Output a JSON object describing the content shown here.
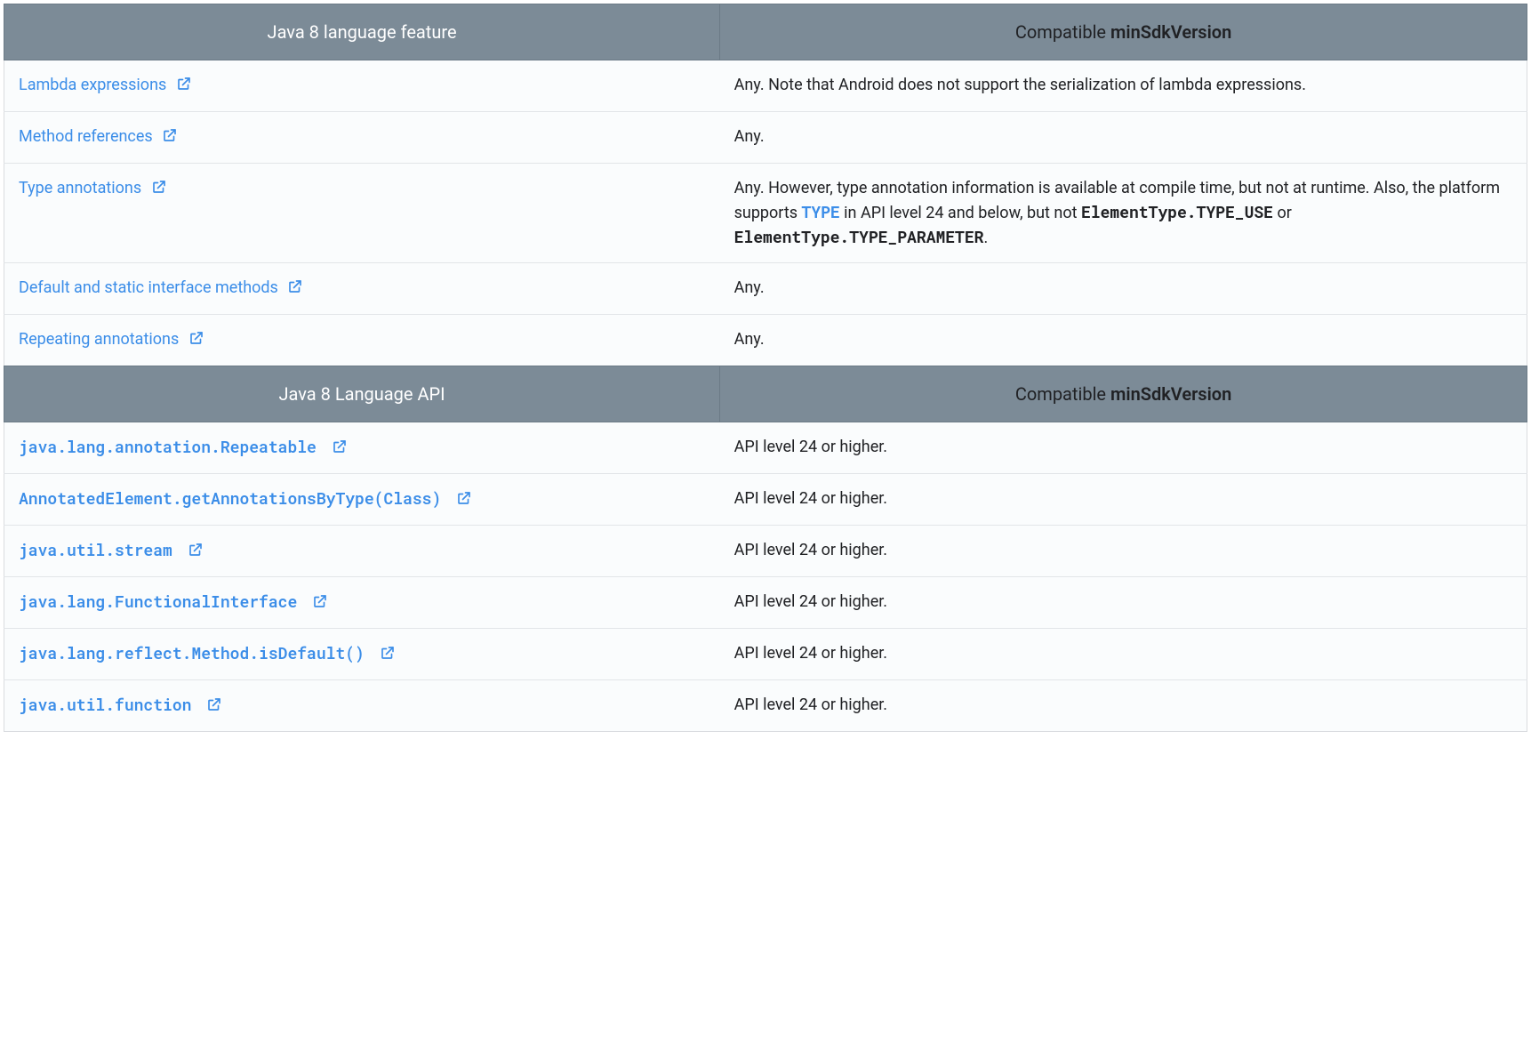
{
  "table1": {
    "header": {
      "left": "Java 8 language feature",
      "right_prefix": "Compatible ",
      "right_bold": "minSdkVersion"
    },
    "rows": [
      {
        "link": "Lambda expressions",
        "desc_plain": "Any. Note that Android does not support the serialization of lambda expressions."
      },
      {
        "link": "Method references",
        "desc_plain": "Any."
      },
      {
        "link": "Type annotations",
        "desc_rich": {
          "p1": "Any. However, type annotation information is available at compile time, but not at runtime. Also, the platform supports ",
          "link1": "TYPE",
          "p2": " in API level 24 and below, but not ",
          "code1": "ElementType.TYPE_USE",
          "p3": " or ",
          "code2": "ElementType.TYPE_PARAMETER",
          "p4": "."
        }
      },
      {
        "link": "Default and static interface methods",
        "desc_plain": "Any."
      },
      {
        "link": "Repeating annotations",
        "desc_plain": "Any."
      }
    ]
  },
  "table2": {
    "header": {
      "left": "Java 8 Language API",
      "right_prefix": "Compatible ",
      "right_bold": "minSdkVersion"
    },
    "rows": [
      {
        "link": "java.lang.annotation.Repeatable",
        "desc": "API level 24 or higher."
      },
      {
        "link": "AnnotatedElement.getAnnotationsByType(Class)",
        "desc": "API level 24 or higher."
      },
      {
        "link": "java.util.stream",
        "desc": "API level 24 or higher."
      },
      {
        "link": "java.lang.FunctionalInterface",
        "desc": "API level 24 or higher."
      },
      {
        "link": "java.lang.reflect.Method.isDefault()",
        "desc": "API level 24 or higher."
      },
      {
        "link": "java.util.function",
        "desc": "API level 24 or higher."
      }
    ]
  }
}
